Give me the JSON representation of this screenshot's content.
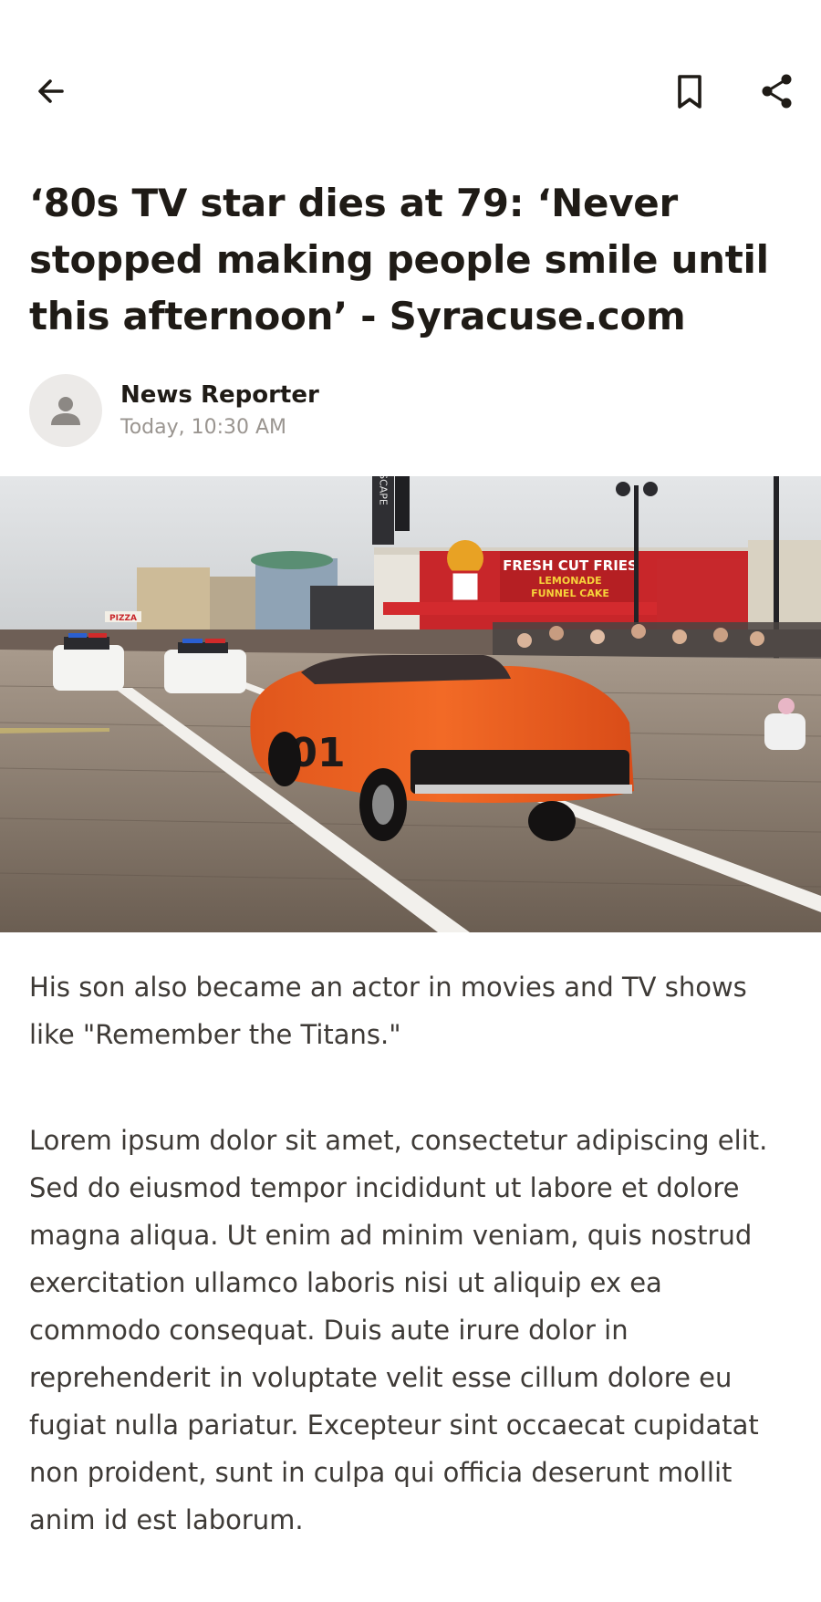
{
  "toolbar": {
    "back_icon": "arrow-left-icon",
    "bookmark_icon": "bookmark-icon",
    "share_icon": "share-icon"
  },
  "article": {
    "headline": "‘80s TV star dies at 79: ‘Never stopped making people smile until this afternoon’ - Syracuse.com",
    "author": "News Reporter",
    "timestamp": "Today, 10:30 AM",
    "avatar_icon": "person-icon",
    "paragraphs": [
      "His son also became an actor in movies and TV shows like \"Remember the Titans.\"",
      "Lorem ipsum dolor sit amet, consectetur adipiscing elit. Sed do eiusmod tempor incididunt ut labore et dolore magna aliqua. Ut enim ad minim veniam, quis nostrud exercitation ullamco laboris nisi ut aliquip ex ea commodo consequat. Duis aute irure dolor in reprehenderit in voluptate velit esse cillum dolore eu fugiat nulla pariatur. Excepteur sint occaecat cupidatat non proident, sunt in culpa qui officia deserunt mollit anim id est laborum."
    ]
  },
  "hero_image": {
    "signs": {
      "fries_line1": "FRESH CUT FRIES",
      "fries_line2": "LEMONADE",
      "fries_line3": "FUNNEL CAKE",
      "pizza": "PIZZA",
      "scape": "SCAPE",
      "car_number": "01"
    }
  },
  "colors": {
    "text_primary": "#1f1b16",
    "text_secondary": "#9a9590",
    "body_text": "#3e3a36",
    "avatar_bg": "#eceae8"
  }
}
